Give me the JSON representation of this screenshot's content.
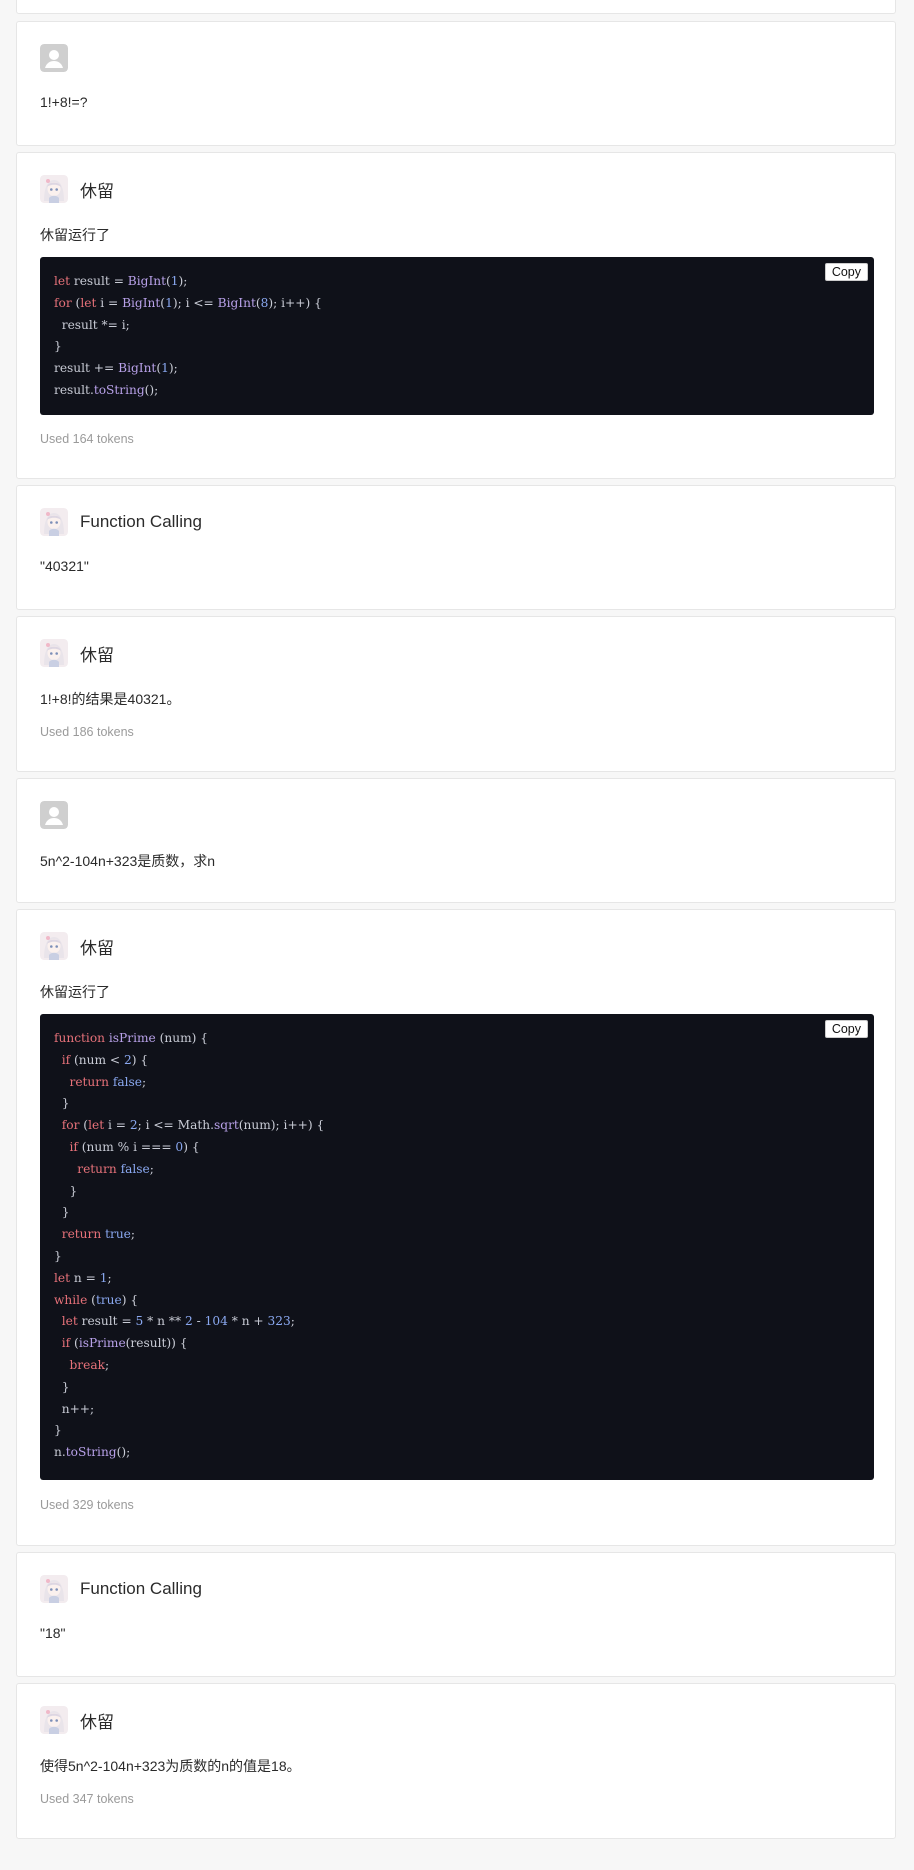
{
  "messages": [
    {
      "id": "m1",
      "role": "user",
      "text": "1!+8!=?"
    },
    {
      "id": "m2",
      "role": "bot",
      "name": "休留",
      "text": "休留运行了",
      "copy_label": "Copy",
      "code_lines": [
        [
          [
            "k",
            "let"
          ],
          [
            "t",
            " result = "
          ],
          [
            "f",
            "BigInt"
          ],
          [
            "t",
            "("
          ],
          [
            "n",
            "1"
          ],
          [
            "t",
            ");"
          ]
        ],
        [
          [
            "k",
            "for"
          ],
          [
            "t",
            " ("
          ],
          [
            "k",
            "let"
          ],
          [
            "t",
            " i = "
          ],
          [
            "f",
            "BigInt"
          ],
          [
            "t",
            "("
          ],
          [
            "n",
            "1"
          ],
          [
            "t",
            "); i <= "
          ],
          [
            "f",
            "BigInt"
          ],
          [
            "t",
            "("
          ],
          [
            "n",
            "8"
          ],
          [
            "t",
            "); i++) {"
          ]
        ],
        [
          [
            "t",
            "  result *= i;"
          ]
        ],
        [
          [
            "t",
            "}"
          ]
        ],
        [
          [
            "t",
            "result += "
          ],
          [
            "f",
            "BigInt"
          ],
          [
            "t",
            "("
          ],
          [
            "n",
            "1"
          ],
          [
            "t",
            ");"
          ]
        ],
        [
          [
            "t",
            "result."
          ],
          [
            "f",
            "toString"
          ],
          [
            "t",
            "();"
          ]
        ]
      ],
      "tokens": "Used 164 tokens"
    },
    {
      "id": "m3",
      "role": "function",
      "name": "Function Calling",
      "text": "\"40321\""
    },
    {
      "id": "m4",
      "role": "bot",
      "name": "休留",
      "text": "1!+8!的结果是40321。",
      "tokens": "Used 186 tokens"
    },
    {
      "id": "m5",
      "role": "user",
      "text": "5n^2-104n+323是质数，求n"
    },
    {
      "id": "m6",
      "role": "bot",
      "name": "休留",
      "text": "休留运行了",
      "copy_label": "Copy",
      "code_lines": [
        [
          [
            "k",
            "function"
          ],
          [
            "t",
            " "
          ],
          [
            "f",
            "isPrime"
          ],
          [
            "t",
            " (num) {"
          ]
        ],
        [
          [
            "t",
            "  "
          ],
          [
            "k",
            "if"
          ],
          [
            "t",
            " (num < "
          ],
          [
            "n",
            "2"
          ],
          [
            "t",
            ") {"
          ]
        ],
        [
          [
            "t",
            "    "
          ],
          [
            "k",
            "return"
          ],
          [
            "t",
            " "
          ],
          [
            "n",
            "false"
          ],
          [
            "t",
            ";"
          ]
        ],
        [
          [
            "t",
            "  }"
          ]
        ],
        [
          [
            "t",
            "  "
          ],
          [
            "k",
            "for"
          ],
          [
            "t",
            " ("
          ],
          [
            "k",
            "let"
          ],
          [
            "t",
            " i = "
          ],
          [
            "n",
            "2"
          ],
          [
            "t",
            "; i <= Math."
          ],
          [
            "f",
            "sqrt"
          ],
          [
            "t",
            "(num); i++) {"
          ]
        ],
        [
          [
            "t",
            "    "
          ],
          [
            "k",
            "if"
          ],
          [
            "t",
            " (num % i === "
          ],
          [
            "n",
            "0"
          ],
          [
            "t",
            ") {"
          ]
        ],
        [
          [
            "t",
            "      "
          ],
          [
            "k",
            "return"
          ],
          [
            "t",
            " "
          ],
          [
            "n",
            "false"
          ],
          [
            "t",
            ";"
          ]
        ],
        [
          [
            "t",
            "    }"
          ]
        ],
        [
          [
            "t",
            "  }"
          ]
        ],
        [
          [
            "t",
            "  "
          ],
          [
            "k",
            "return"
          ],
          [
            "t",
            " "
          ],
          [
            "n",
            "true"
          ],
          [
            "t",
            ";"
          ]
        ],
        [
          [
            "t",
            "}"
          ]
        ],
        [
          [
            "k",
            "let"
          ],
          [
            "t",
            " n = "
          ],
          [
            "n",
            "1"
          ],
          [
            "t",
            ";"
          ]
        ],
        [
          [
            "k",
            "while"
          ],
          [
            "t",
            " ("
          ],
          [
            "n",
            "true"
          ],
          [
            "t",
            ") {"
          ]
        ],
        [
          [
            "t",
            "  "
          ],
          [
            "k",
            "let"
          ],
          [
            "t",
            " result = "
          ],
          [
            "n",
            "5"
          ],
          [
            "t",
            " * n ** "
          ],
          [
            "n",
            "2"
          ],
          [
            "t",
            " - "
          ],
          [
            "n",
            "104"
          ],
          [
            "t",
            " * n + "
          ],
          [
            "n",
            "323"
          ],
          [
            "t",
            ";"
          ]
        ],
        [
          [
            "t",
            "  "
          ],
          [
            "k",
            "if"
          ],
          [
            "t",
            " ("
          ],
          [
            "f",
            "isPrime"
          ],
          [
            "t",
            "(result)) {"
          ]
        ],
        [
          [
            "t",
            "    "
          ],
          [
            "k",
            "break"
          ],
          [
            "t",
            ";"
          ]
        ],
        [
          [
            "t",
            "  }"
          ]
        ],
        [
          [
            "t",
            "  n++;"
          ]
        ],
        [
          [
            "t",
            "}"
          ]
        ],
        [
          [
            "t",
            "n."
          ],
          [
            "f",
            "toString"
          ],
          [
            "t",
            "();"
          ]
        ]
      ],
      "tokens": "Used 329 tokens"
    },
    {
      "id": "m7",
      "role": "function",
      "name": "Function Calling",
      "text": "\"18\""
    },
    {
      "id": "m8",
      "role": "bot",
      "name": "休留",
      "text": "使得5n^2-104n+323为质数的n的值是18。",
      "tokens": "Used 347 tokens"
    }
  ],
  "colors": {
    "keyword": "#e8727a",
    "function": "#b9a2ea",
    "number": "#8aa8f0",
    "code_bg": "#0f1119"
  },
  "icons": {
    "user": "default-user-avatar-icon",
    "bot": "anime-girl-avatar-icon"
  }
}
